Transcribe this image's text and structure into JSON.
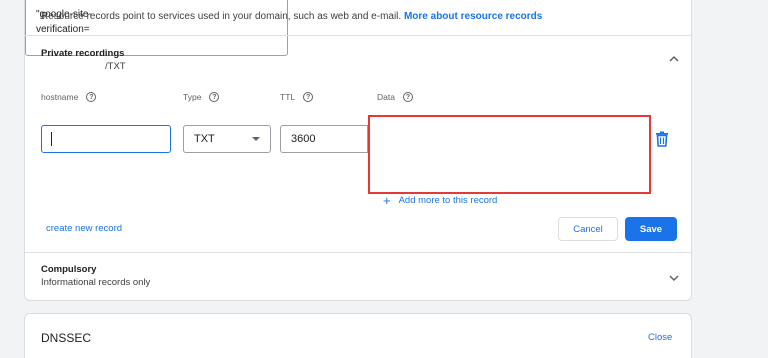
{
  "intro": {
    "text": "Resource records point to services used in your domain, such as web and e-mail. ",
    "link": "More about resource records"
  },
  "private_section": {
    "title": "Private recordings",
    "subtitle": "/TXT"
  },
  "columns": {
    "hostname": "hostname",
    "type": "Type",
    "ttl": "TTL",
    "data": "Data"
  },
  "record": {
    "hostname_value": "",
    "type_value": "TXT",
    "ttl_value": "3600",
    "data_value": "\"google-site-\nverification="
  },
  "actions": {
    "add_more": "Add more to this record",
    "create_new": "create new record",
    "cancel": "Cancel",
    "save": "Save"
  },
  "compulsory_section": {
    "title": "Compulsory",
    "subtitle": "Informational records only"
  },
  "dnssec": {
    "title": "DNSSEC",
    "close": "Close"
  },
  "colors": {
    "accent": "#1a73e8",
    "highlight": "#e53935"
  }
}
